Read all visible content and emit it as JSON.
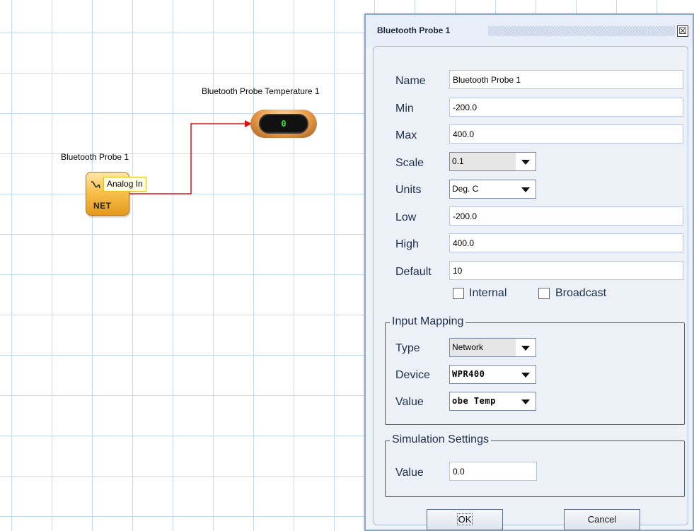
{
  "canvas": {
    "probe_node_label": "Bluetooth Probe 1",
    "probe_block_text": "NET",
    "probe_port_tag": "Analog In",
    "display_node_label": "Bluetooth Probe Temperature 1",
    "display_value": "0",
    "wire_color": "#e01010"
  },
  "dialog": {
    "title": "Bluetooth Probe 1",
    "close_glyph": "☒",
    "fields": {
      "name_label": "Name",
      "name_value": "Bluetooth Probe 1",
      "min_label": "Min",
      "min_value": "-200.0",
      "max_label": "Max",
      "max_value": "400.0",
      "scale_label": "Scale",
      "scale_value": "0.1",
      "units_label": "Units",
      "units_value": "Deg. C",
      "low_label": "Low",
      "low_value": "-200.0",
      "high_label": "High",
      "high_value": "400.0",
      "default_label": "Default",
      "default_value": "10"
    },
    "checkboxes": {
      "internal_label": "Internal",
      "internal_checked": false,
      "broadcast_label": "Broadcast",
      "broadcast_checked": false
    },
    "input_mapping": {
      "title": "Input Mapping",
      "type_label": "Type",
      "type_value": "Network",
      "device_label": "Device",
      "device_value": "WPR400",
      "value_label": "Value",
      "value_value": "obe Temp"
    },
    "simulation": {
      "title": "Simulation Settings",
      "value_label": "Value",
      "value_value": "0.0"
    },
    "buttons": {
      "ok": "OK",
      "cancel": "Cancel"
    }
  }
}
